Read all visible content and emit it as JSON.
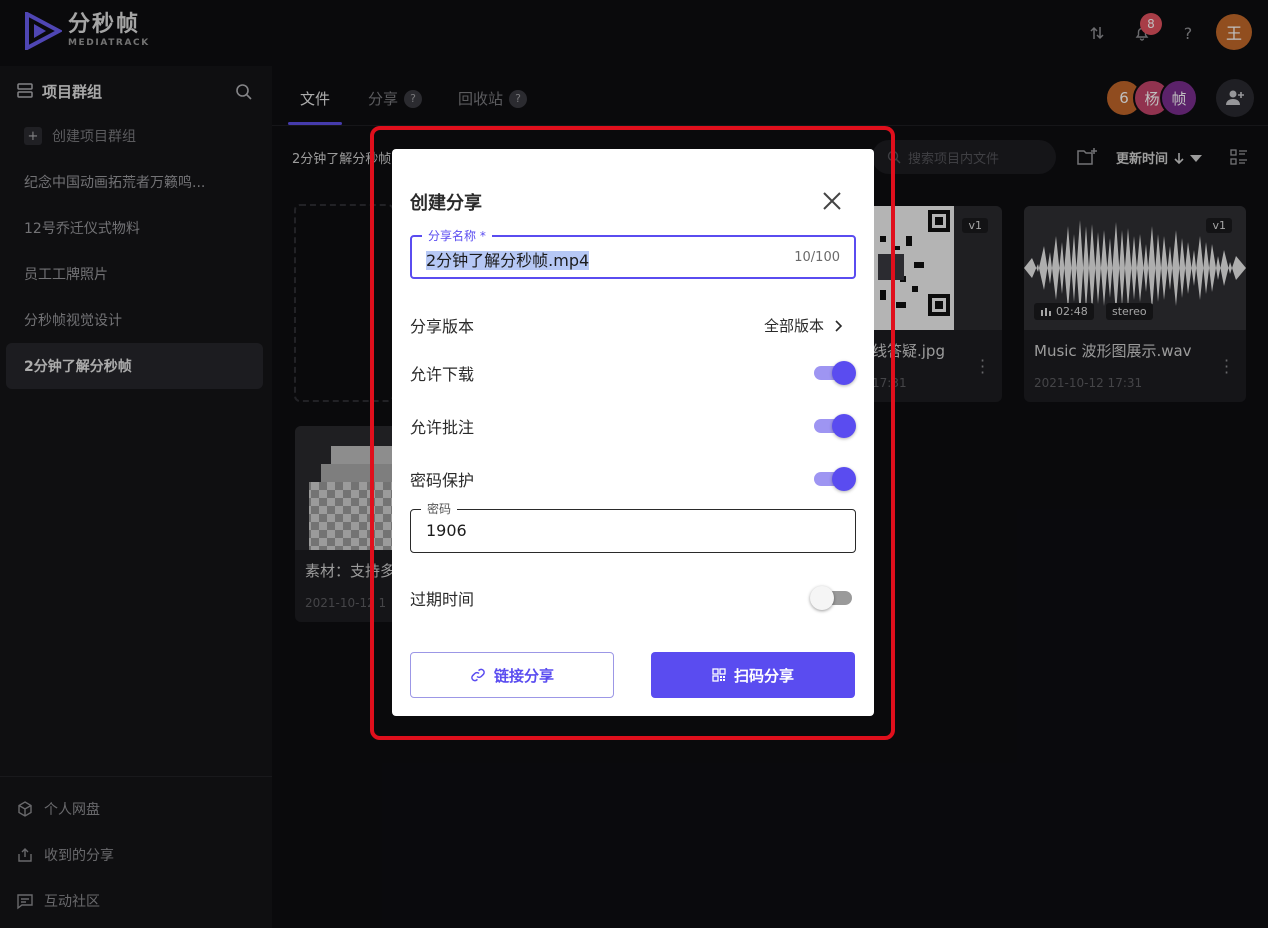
{
  "app": {
    "logo_title": "分秒帧",
    "logo_subtitle": "MEDIATRACK",
    "notification_count": "8",
    "help_label": "?",
    "user_initial": "王"
  },
  "sidebar": {
    "header_label": "项目群组",
    "create_label": "创建项目群组",
    "items": [
      {
        "label": "纪念中国动画拓荒者万籁鸣..."
      },
      {
        "label": "12号乔迁仪式物料"
      },
      {
        "label": "员工工牌照片"
      },
      {
        "label": "分秒帧视觉设计"
      },
      {
        "label": "2分钟了解分秒帧"
      }
    ],
    "bottom": [
      {
        "label": "个人网盘",
        "icon": "cube-icon"
      },
      {
        "label": "收到的分享",
        "icon": "share-in-icon"
      },
      {
        "label": "互动社区",
        "icon": "chat-icon"
      }
    ]
  },
  "tabs": [
    {
      "label": "文件"
    },
    {
      "label": "分享",
      "help": "?"
    },
    {
      "label": "回收站",
      "help": "?"
    }
  ],
  "members": [
    {
      "label": "6",
      "color": "#c0662a"
    },
    {
      "label": "杨",
      "color": "#c2456a"
    },
    {
      "label": "帧",
      "color": "#7a2e8e"
    }
  ],
  "toolbar": {
    "breadcrumb": "2分钟了解分秒帧",
    "search_placeholder": "搜索项目内文件",
    "sort_label": "更新时间"
  },
  "cards": [
    {
      "title": "线答疑.jpg",
      "date": "17:31",
      "version": "v1"
    },
    {
      "title": "Music 波形图展示.wav",
      "date": "2021-10-12 17:31",
      "version": "v1",
      "duration": "02:48",
      "channel": "stereo"
    },
    {
      "title": "素材：支持多",
      "date": "2021-10-12 1"
    }
  ],
  "dialog": {
    "title": "创建分享",
    "name_legend": "分享名称 *",
    "name_value": "2分钟了解分秒帧.mp4",
    "name_count": "10/100",
    "version_label": "分享版本",
    "version_value": "全部版本",
    "allow_download_label": "允许下载",
    "allow_download": true,
    "allow_comment_label": "允许批注",
    "allow_comment": true,
    "password_protect_label": "密码保护",
    "password_protect": true,
    "password_legend": "密码",
    "password_value": "1906",
    "expiry_label": "过期时间",
    "expiry": false,
    "link_share_label": "链接分享",
    "qr_share_label": "扫码分享"
  },
  "colors": {
    "accent": "#5a4cf0",
    "highlight": "#e00f1c"
  }
}
